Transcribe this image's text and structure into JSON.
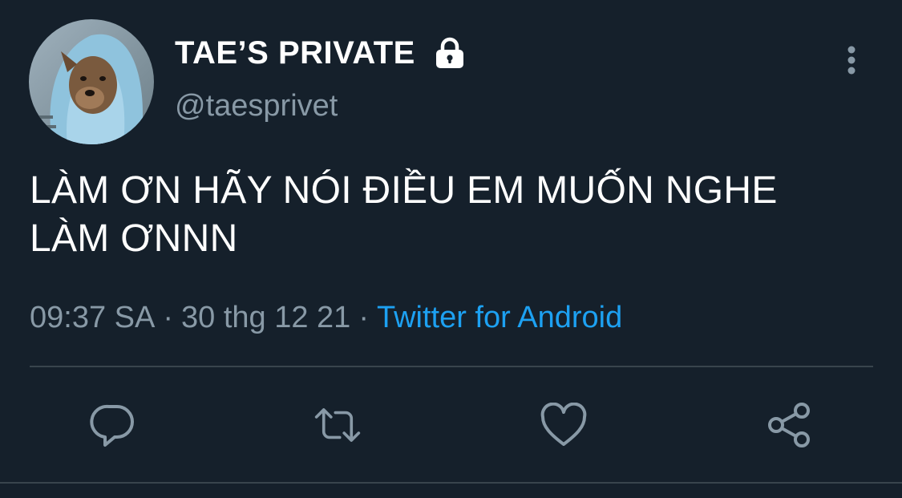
{
  "tweet": {
    "display_name": "TAE’S PRIVATE",
    "handle": "@taesprivet",
    "text_lines": [
      "LÀM ƠN HÃY NÓI ĐIỀU EM MUỐN NGHE",
      "LÀM ƠNNN"
    ],
    "time": "09:37 SA",
    "separator": "·",
    "date": "30 thg 12 21",
    "source": "Twitter for Android"
  },
  "icons": {
    "lock": "lock-icon",
    "more": "more-vertical-icon",
    "reply": "reply-icon",
    "retweet": "retweet-icon",
    "like": "heart-icon",
    "share": "share-icon"
  },
  "colors": {
    "background": "#15202b",
    "primary_text": "#ffffff",
    "secondary_text": "#8899a6",
    "accent": "#1da1f2",
    "divider": "#38444d"
  }
}
